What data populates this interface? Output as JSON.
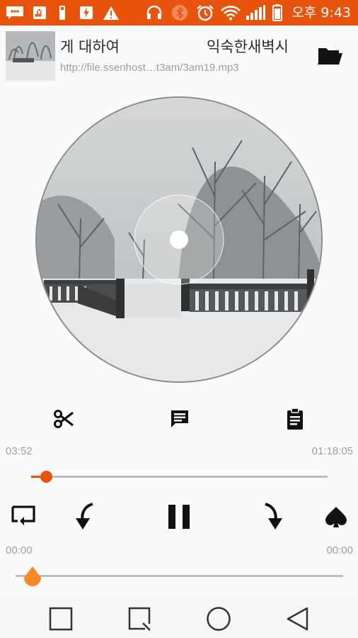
{
  "status_bar": {
    "time": "오후 9:43",
    "icons": [
      "message-icon",
      "music-icon",
      "usb-icon",
      "battery-saver-icon",
      "warning-icon",
      "headset-icon",
      "bluetooth-off-icon",
      "alarm-icon",
      "wifi-icon",
      "signal-icon",
      "battery-icon"
    ]
  },
  "track": {
    "title_left": "게 대하여",
    "title_right": "익숙한새벽시",
    "url": "http://file.ssenhost…t3am/3am19.mp3"
  },
  "tools": {
    "cut_icon": "scissors-icon",
    "lyrics_icon": "message-text-icon",
    "clipboard_icon": "clipboard-icon"
  },
  "progress": {
    "elapsed": "03:52",
    "total": "01:18:05",
    "fraction": 0.05
  },
  "controls": {
    "repeat_icon": "repeat-icon",
    "rewind_icon": "rewind-icon",
    "pause_icon": "pause-icon",
    "forward_icon": "forward-icon",
    "favorite_icon": "spade-heart-icon"
  },
  "ab_section": {
    "start": "00:00",
    "end": "00:00",
    "fraction": 0.0
  },
  "colors": {
    "accent": "#e8540e",
    "ab_thumb": "#f5892a",
    "track_grey": "#bdbdbd"
  }
}
